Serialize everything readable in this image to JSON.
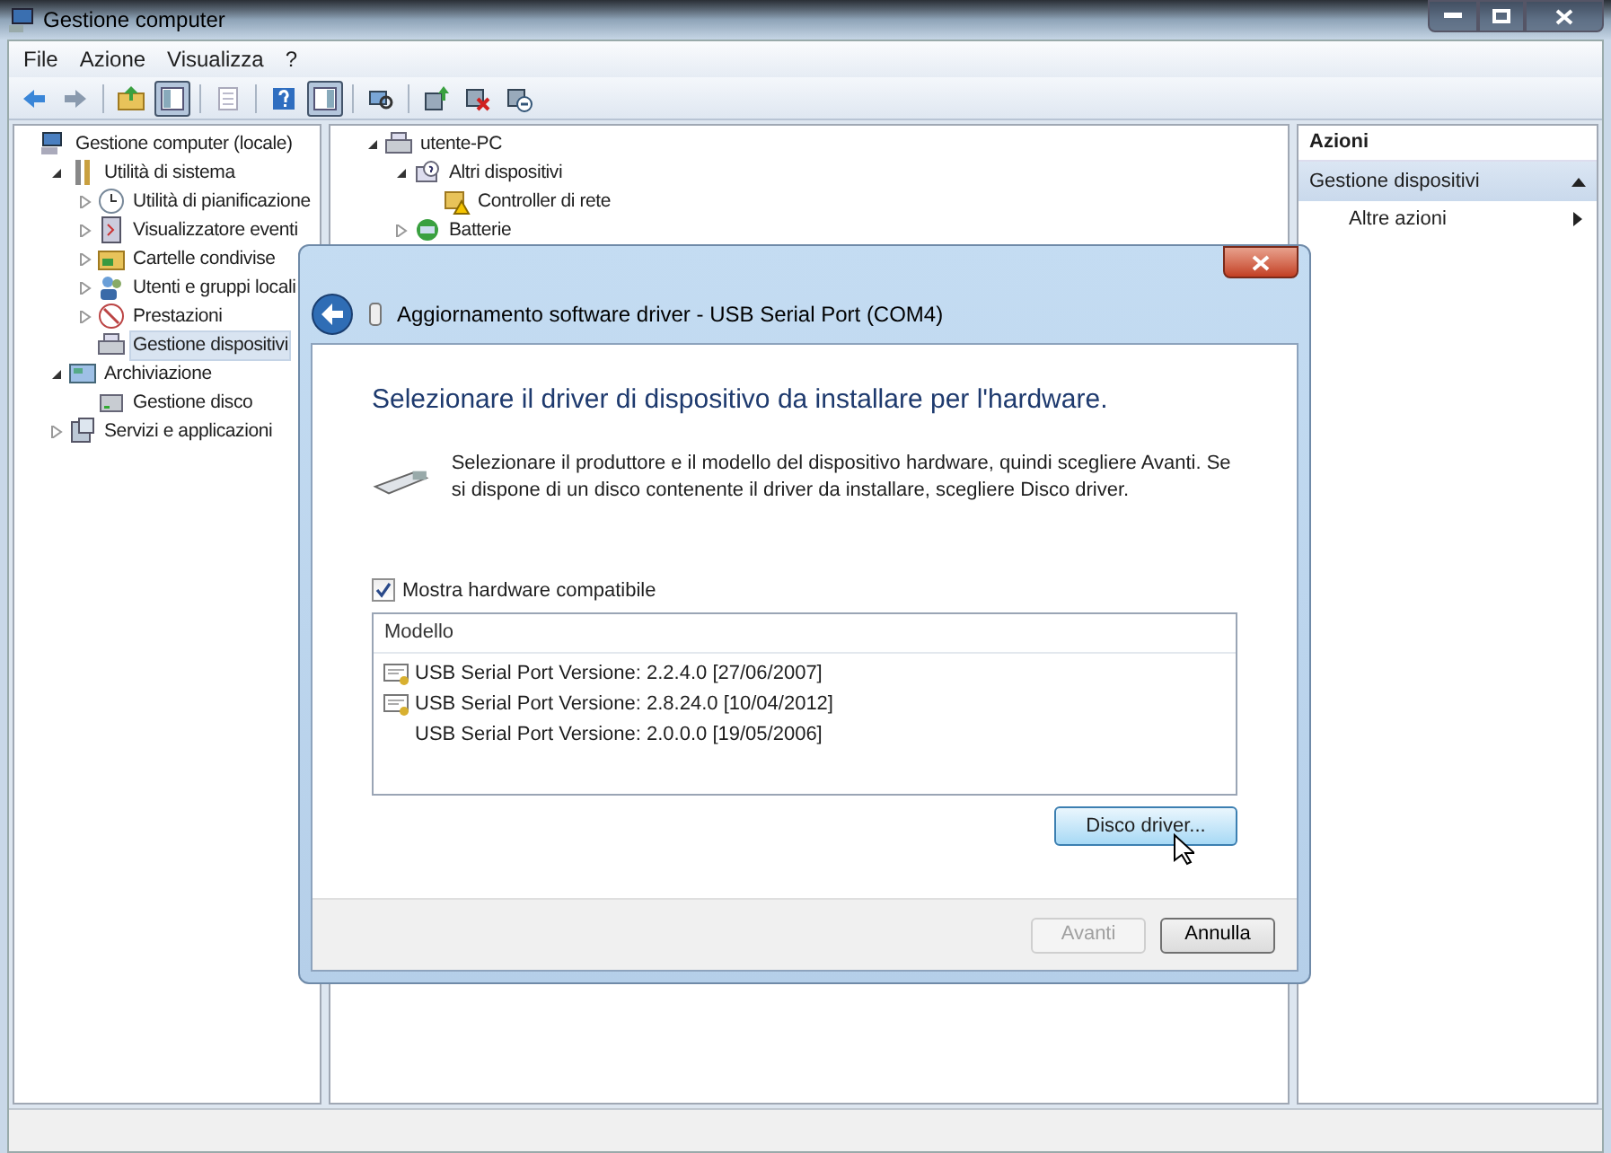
{
  "window": {
    "title": "Gestione computer"
  },
  "menu": [
    "File",
    "Azione",
    "Visualizza",
    "?"
  ],
  "toolbar": [
    {
      "pressed": false
    },
    {
      "pressed": false
    },
    {
      "pressed": false
    },
    {
      "pressed": true
    },
    {
      "pressed": false
    },
    {
      "pressed": false
    },
    {
      "pressed": true
    },
    {
      "pressed": false
    },
    {
      "pressed": false
    },
    {
      "pressed": false
    },
    {
      "pressed": false
    }
  ],
  "console_tree": [
    {
      "label": "Gestione computer (locale)",
      "selected": false,
      "children": [
        {
          "label": "Utilità di sistema",
          "expanded": true,
          "selected": false,
          "children": [
            {
              "label": "Utilità di pianificazione",
              "expanded": false,
              "selected": false
            },
            {
              "label": "Visualizzatore eventi",
              "expanded": false,
              "selected": false
            },
            {
              "label": "Cartelle condivise",
              "expanded": false,
              "selected": false
            },
            {
              "label": "Utenti e gruppi locali",
              "expanded": false,
              "selected": false
            },
            {
              "label": "Prestazioni",
              "expanded": false,
              "selected": false
            },
            {
              "label": "Gestione dispositivi",
              "selected": true
            }
          ]
        },
        {
          "label": "Archiviazione",
          "expanded": true,
          "selected": false,
          "children": [
            {
              "label": "Gestione disco",
              "selected": false
            }
          ]
        },
        {
          "label": "Servizi e applicazioni",
          "expanded": false,
          "selected": false
        }
      ]
    }
  ],
  "device_tree": [
    {
      "label": "utente-PC",
      "expanded": true,
      "children": [
        {
          "label": "Altri dispositivi",
          "expanded": true,
          "children": [
            {
              "label": "Controller di rete"
            }
          ]
        },
        {
          "label": "Batterie",
          "expanded": false
        }
      ]
    }
  ],
  "actions": {
    "title": "Azioni",
    "sections": [
      {
        "label": "Gestione dispositivi",
        "expanded": true,
        "items": [
          {
            "label": "Altre azioni"
          }
        ]
      }
    ]
  },
  "dialog": {
    "title": "Aggiornamento software driver - USB Serial Port (COM4)",
    "heading": "Selezionare il driver di dispositivo da installare per l'hardware.",
    "description": "Selezionare il produttore e il modello del dispositivo hardware, quindi scegliere Avanti. Se si dispone di un disco contenente il driver da installare, scegliere Disco driver.",
    "compatible_checkbox": {
      "label": "Mostra hardware compatibile",
      "checked": true
    },
    "model_list": {
      "column": "Modello",
      "rows": [
        {
          "label": "USB Serial Port Versione: 2.2.4.0 [27/06/2007]",
          "signed": true,
          "selected": false
        },
        {
          "label": "USB Serial Port Versione: 2.8.24.0 [10/04/2012]",
          "signed": true,
          "selected": false
        },
        {
          "label": "USB Serial Port Versione: 2.0.0.0 [19/05/2006]",
          "signed": false,
          "selected": false
        }
      ]
    },
    "disk_button": "Disco driver...",
    "buttons": [
      {
        "label": "Avanti",
        "disabled": true
      },
      {
        "label": "Annulla",
        "disabled": false
      }
    ]
  }
}
